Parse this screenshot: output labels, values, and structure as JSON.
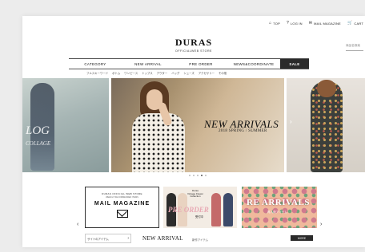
{
  "utility": {
    "items": [
      {
        "icon": "home-icon",
        "glyph": "⌂",
        "label": "TOP"
      },
      {
        "icon": "lock-icon",
        "glyph": "?",
        "label": "LOG IN"
      },
      {
        "icon": "mail-icon",
        "glyph": "✉",
        "label": "MAIL MAGAZINE"
      },
      {
        "icon": "cart-icon",
        "glyph": "🛒",
        "label": "CART"
      }
    ]
  },
  "logo": {
    "name": "DURAS",
    "sub": "OFFICIALWEB STORE"
  },
  "search": {
    "placeholder": "商品名検索"
  },
  "mainnav": {
    "items": [
      "CATEGORY",
      "NEW ARRIVAL",
      "PRE ORDER",
      "NEWS&COORDINATE",
      "SALE"
    ]
  },
  "subnav": {
    "items": [
      "フルスキーワード",
      "ボトム",
      "ワンピース",
      "トップス",
      "アウター",
      "バッグ",
      "シューズ",
      "アクセサリー",
      "その他"
    ]
  },
  "hero": {
    "left_text_1": "LOG",
    "left_text_2": "COLLAGE",
    "headline": "NEW ARRIVALS",
    "tagline": "2018 SPRING / SUMMER",
    "arrow_left": "‹",
    "arrow_right": "›",
    "slides": 5,
    "active_slide": 3
  },
  "banners": {
    "mail": {
      "line1": "DURAS OFFICIAL WEB STORE",
      "line2": "WEEKLY RECOMMENDED ITEMS",
      "title": "MAIL MAGAZINE"
    },
    "preorder": {
      "label_1": "Duras",
      "label_2": "Vintage Flower",
      "label_3": "Collection",
      "title": "PRE ORDER",
      "sub": "受付中"
    },
    "rearrivals": {
      "title": "RE ARRIVALS",
      "sub": "再入荷アイテム"
    },
    "arrow_left": "‹",
    "arrow_right": "›"
  },
  "bottom": {
    "recent": "サイトのアイテム",
    "chevron": "›",
    "new_arrival": "NEW ARRIVAL",
    "new_arrival_sub": "新作アイテム",
    "more": "MORE"
  }
}
